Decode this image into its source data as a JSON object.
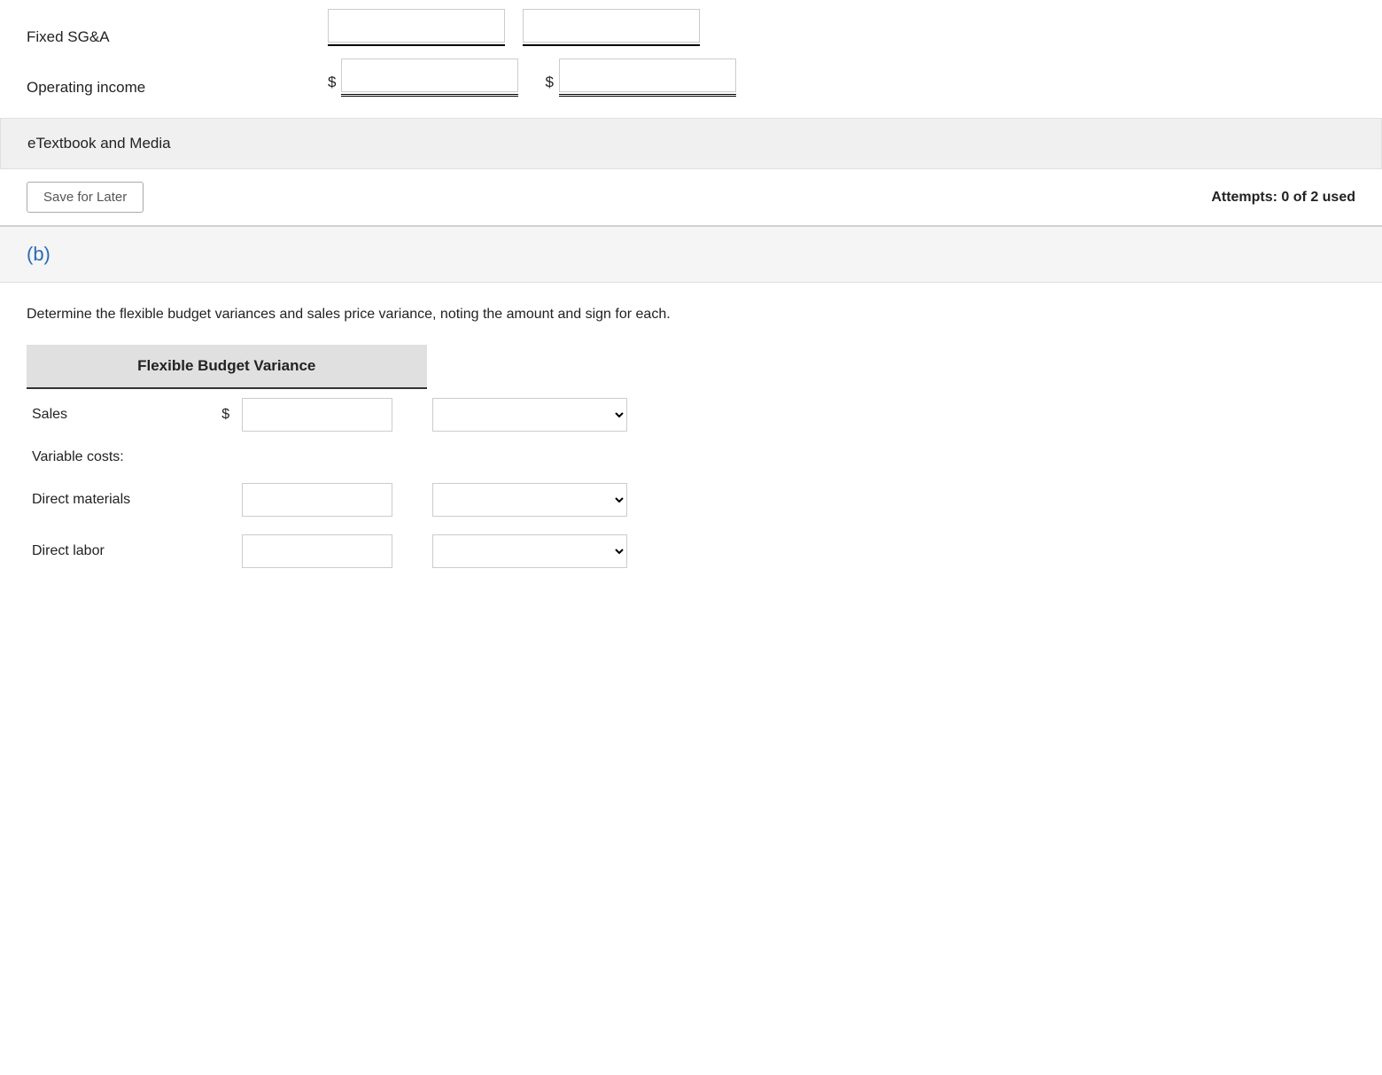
{
  "fixedSGA": {
    "label": "Fixed SG&A",
    "input1_placeholder": "",
    "input2_placeholder": ""
  },
  "operatingIncome": {
    "label": "Operating income",
    "dollar_sign": "$",
    "input1_placeholder": "",
    "input2_placeholder": ""
  },
  "etextbook": {
    "label": "eTextbook and Media"
  },
  "saveButton": {
    "label": "Save for Later"
  },
  "attempts": {
    "label": "Attempts: 0 of 2 used"
  },
  "sectionB": {
    "label": "(b)",
    "instruction": "Determine the flexible budget variances and sales price variance, noting the amount and sign for each.",
    "table": {
      "header": "Flexible Budget Variance",
      "rows": [
        {
          "label": "Sales",
          "hasDollar": true,
          "hasInput": true,
          "hasSelect": true
        },
        {
          "label": "Variable costs:",
          "hasDollar": false,
          "hasInput": false,
          "hasSelect": false,
          "isSubheader": true
        },
        {
          "label": "Direct materials",
          "hasDollar": false,
          "hasInput": true,
          "hasSelect": true
        },
        {
          "label": "Direct labor",
          "hasDollar": false,
          "hasInput": true,
          "hasSelect": true
        }
      ]
    }
  }
}
